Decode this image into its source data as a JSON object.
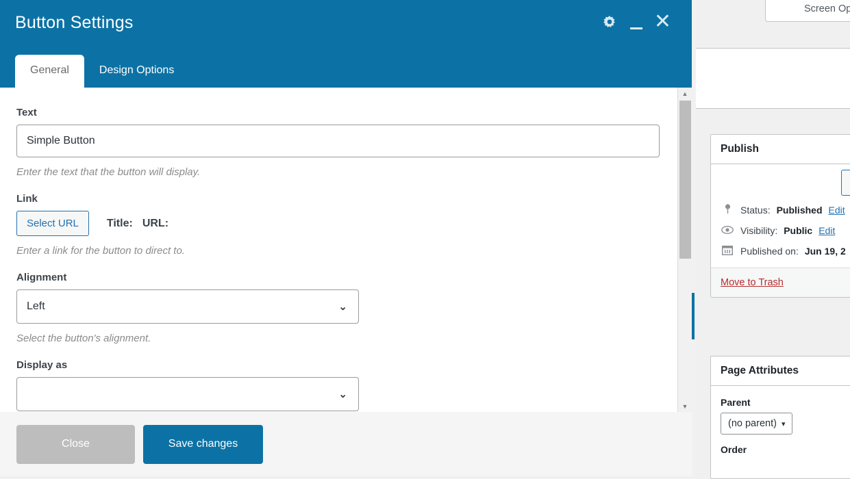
{
  "background": {
    "screen_options_label": "Screen Options",
    "publish": {
      "title": "Publish",
      "status_label": "Status:",
      "status_value": "Published",
      "status_edit": "Edit",
      "visibility_label": "Visibility:",
      "visibility_value": "Public",
      "visibility_edit": "Edit",
      "published_on_label": "Published on:",
      "published_on_value": "Jun 19, 2",
      "move_to_trash": "Move to Trash"
    },
    "page_attributes": {
      "title": "Page Attributes",
      "parent_label": "Parent",
      "parent_value": "(no parent)",
      "order_label": "Order"
    }
  },
  "modal": {
    "title": "Button Settings",
    "header_icons": {
      "gear": "gear-icon",
      "minimize": "minimize-icon",
      "close": "close-icon"
    },
    "tabs": [
      {
        "label": "General",
        "active": true
      },
      {
        "label": "Design Options",
        "active": false
      }
    ],
    "fields": {
      "text": {
        "label": "Text",
        "value": "Simple Button",
        "hint": "Enter the text that the button will display."
      },
      "link": {
        "label": "Link",
        "button_label": "Select URL",
        "title_label": "Title:",
        "url_label": "URL:",
        "hint": "Enter a link for the button to direct to."
      },
      "alignment": {
        "label": "Alignment",
        "value": "Left",
        "hint": "Select the button's alignment.",
        "caret": "⌄"
      },
      "display_as": {
        "label": "Display as"
      }
    },
    "footer": {
      "close_label": "Close",
      "save_label": "Save changes"
    },
    "colors": {
      "header_blue": "#0c72a5",
      "save_blue": "#0c72a5",
      "close_gray": "#bdbdbd",
      "trash_red": "#b32d2e",
      "link_blue": "#2271b1"
    }
  }
}
